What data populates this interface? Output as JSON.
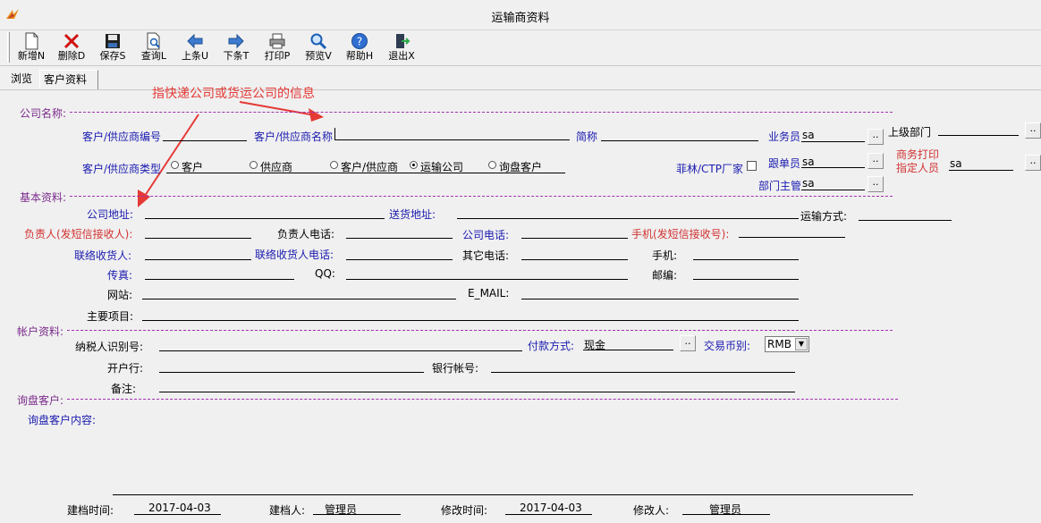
{
  "window": {
    "title": "运输商资料"
  },
  "toolbar": [
    {
      "label": "新增N",
      "icon": "new-doc-icon"
    },
    {
      "label": "删除D",
      "icon": "delete-icon"
    },
    {
      "label": "保存S",
      "icon": "save-icon"
    },
    {
      "label": "查询L",
      "icon": "query-icon"
    },
    {
      "label": "上条U",
      "icon": "left-arrow-icon"
    },
    {
      "label": "下条T",
      "icon": "right-arrow-icon"
    },
    {
      "label": "打印P",
      "icon": "print-icon"
    },
    {
      "label": "预览V",
      "icon": "magnifier-icon"
    },
    {
      "label": "帮助H",
      "icon": "help-icon"
    },
    {
      "label": "退出X",
      "icon": "exit-icon"
    }
  ],
  "tabs": [
    {
      "label": "浏览"
    },
    {
      "label": "客户资料"
    }
  ],
  "annotation": {
    "text": "指快递公司或货运公司的信息",
    "color": "#e53935"
  },
  "company": {
    "section": "公司名称:",
    "code_label": "客户/供应商编号",
    "name_label": "客户/供应商名称",
    "short_label": "简称",
    "salesman_label": "业务员",
    "salesman_value": "sa",
    "parent_dept_label": "上级部门",
    "type_label": "客户/供应商类型",
    "types": [
      "客户",
      "供应商",
      "客户/供应商",
      "运输公司",
      "询盘客户"
    ],
    "selected_type": "运输公司",
    "feilin_label": "菲林/CTP厂家",
    "follower_label": "跟单员",
    "follower_value": "sa",
    "print_person_label1": "商务打印",
    "print_person_label2": "指定人员",
    "print_person_value": "sa",
    "dept_manager_label": "部门主管",
    "dept_manager_value": "sa"
  },
  "basic": {
    "section": "基本资料:",
    "address_label": "公司地址:",
    "delivery_label": "送货地址:",
    "transport_label": "运输方式:",
    "person_label": "负责人(发短信接收人):",
    "person_phone_label": "负责人电话:",
    "company_phone_label": "公司电话:",
    "mobile_sms_label": "手机(发短信接收号):",
    "contact_label": "联络收货人:",
    "contact_phone_label": "联络收货人电话:",
    "other_phone_label": "其它电话:",
    "mobile_label": "手机:",
    "fax_label": "传真:",
    "qq_label": "QQ:",
    "zip_label": "邮编:",
    "website_label": "网站:",
    "email_label": "E_MAIL:",
    "main_items_label": "主要项目:"
  },
  "account": {
    "section": "帐户资料:",
    "tax_label": "纳税人识别号:",
    "payment_label": "付款方式:",
    "payment_value": "现金",
    "currency_label": "交易币别:",
    "currency_value": "RMB",
    "bank_label": "开户行:",
    "bank_account_label": "银行帐号:",
    "remark_label": "备注:"
  },
  "inquiry": {
    "section": "询盘客户:",
    "content_label": "询盘客户内容:"
  },
  "footer": {
    "created_time_label": "建档时间:",
    "created_time": "2017-04-03",
    "creator_label": "建档人:",
    "creator": "管理员",
    "modified_time_label": "修改时间:",
    "modified_time": "2017-04-03",
    "modifier_label": "修改人:",
    "modifier": "管理员"
  },
  "colors": {
    "section": "#7b2b8c",
    "blue_label": "#1a1ab0",
    "red_label": "#d23232",
    "dash": "#a32fb2"
  }
}
